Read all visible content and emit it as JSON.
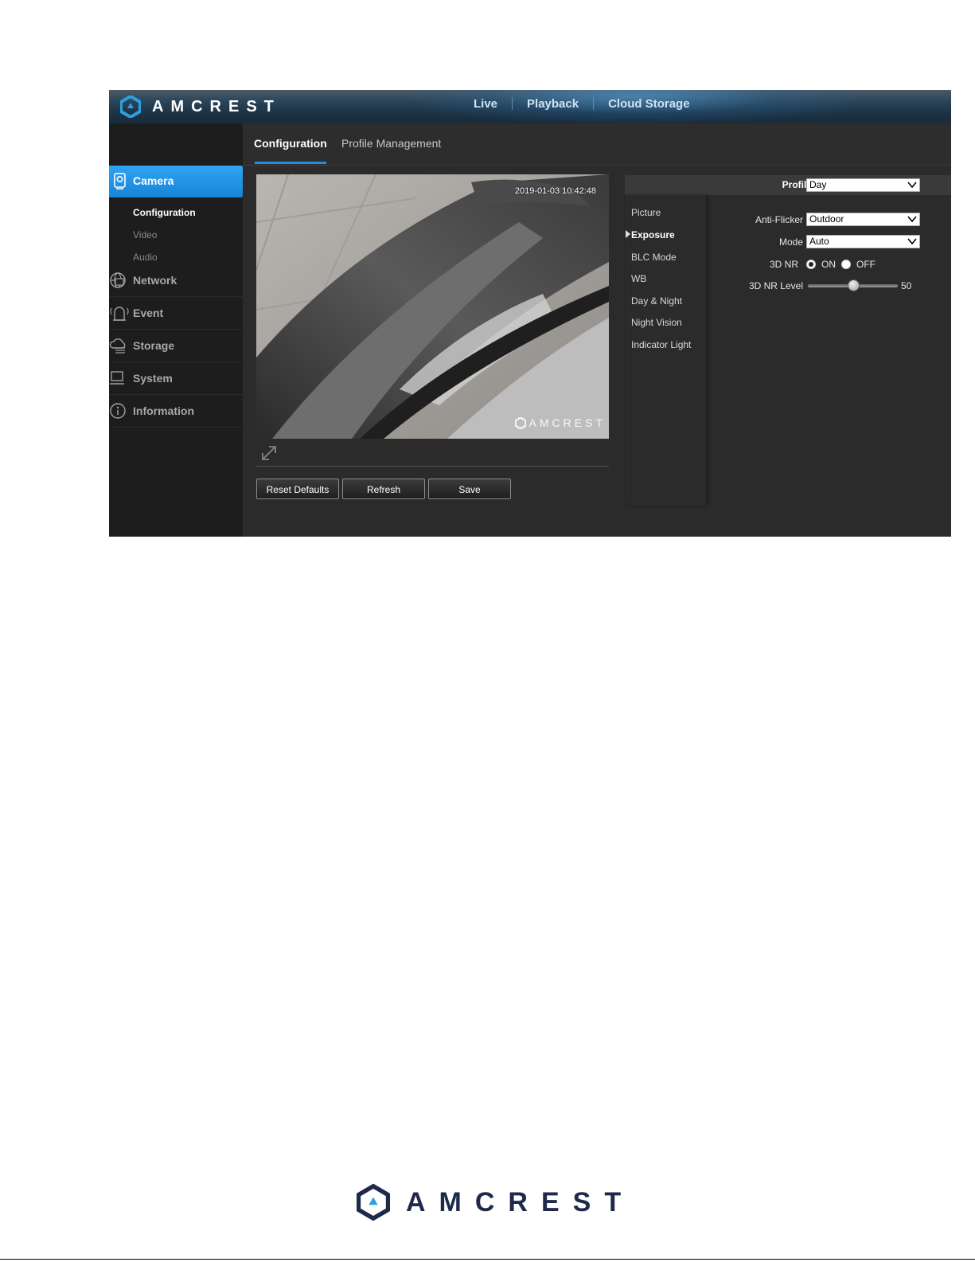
{
  "brand": {
    "name": "AMCREST"
  },
  "topnav": {
    "items": [
      "Live",
      "Playback",
      "Cloud Storage"
    ]
  },
  "tabs": [
    {
      "label": "Configuration",
      "active": true
    },
    {
      "label": "Profile Management",
      "active": false
    }
  ],
  "sidebar": {
    "camera": {
      "label": "Camera",
      "icon": "camera-icon"
    },
    "camera_sub": [
      "Configuration",
      "Video",
      "Audio"
    ],
    "items": [
      {
        "label": "Network",
        "icon": "globe-icon"
      },
      {
        "label": "Event",
        "icon": "alarm-icon"
      },
      {
        "label": "Storage",
        "icon": "cloud-storage-icon"
      },
      {
        "label": "System",
        "icon": "computer-icon"
      },
      {
        "label": "Information",
        "icon": "info-icon"
      }
    ]
  },
  "video": {
    "timestamp": "2019-01-03 10:42:48",
    "watermark": "AMCREST"
  },
  "buttons": {
    "reset": "Reset Defaults",
    "refresh": "Refresh",
    "save": "Save"
  },
  "settings": {
    "profile_label": "Profile",
    "profile_value": "Day",
    "menu": [
      "Picture",
      "Exposure",
      "BLC Mode",
      "WB",
      "Day & Night",
      "Night Vision",
      "Indicator Light"
    ],
    "active_menu": "Exposure",
    "anti_flicker": {
      "label": "Anti-Flicker",
      "value": "Outdoor"
    },
    "mode": {
      "label": "Mode",
      "value": "Auto"
    },
    "nr3d": {
      "label": "3D NR",
      "on_label": "ON",
      "off_label": "OFF",
      "selected": "ON"
    },
    "nr3d_level": {
      "label": "3D NR Level",
      "value": "50",
      "fraction": 0.5
    }
  },
  "colors": {
    "accent": "#1e8fe0",
    "brand_navy": "#1f2a4a",
    "logo_blue": "#2d9fe0"
  }
}
